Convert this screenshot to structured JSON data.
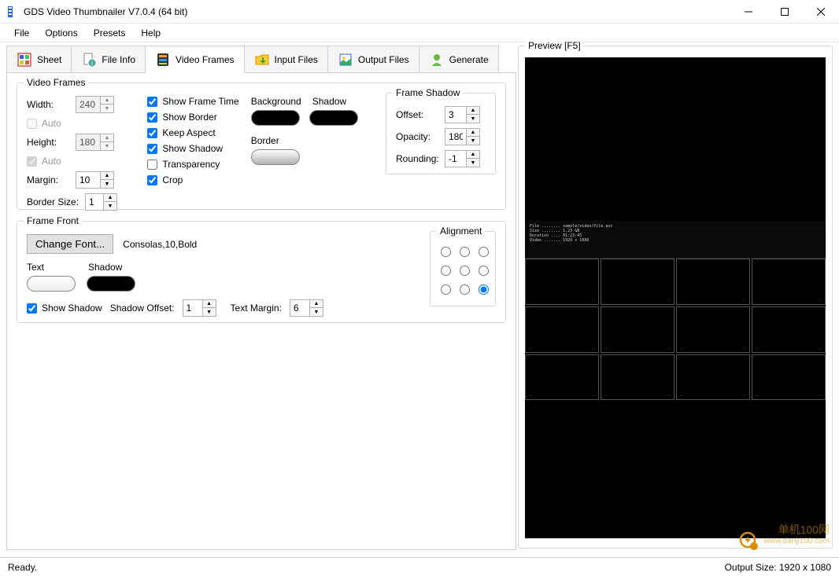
{
  "window": {
    "title": "GDS Video Thumbnailer V7.0.4 (64 bit)"
  },
  "menu": {
    "file": "File",
    "options": "Options",
    "presets": "Presets",
    "help": "Help"
  },
  "tabs": {
    "sheet": "Sheet",
    "fileinfo": "File Info",
    "videoframes": "Video Frames",
    "inputfiles": "Input Files",
    "outputfiles": "Output Files",
    "generate": "Generate"
  },
  "videoFrames": {
    "legend": "Video Frames",
    "width_label": "Width:",
    "width_value": "240",
    "width_auto": "Auto",
    "height_label": "Height:",
    "height_value": "180",
    "height_auto": "Auto",
    "margin_label": "Margin:",
    "margin_value": "10",
    "bordersize_label": "Border Size:",
    "bordersize_value": "1",
    "show_frame_time": "Show Frame Time",
    "show_border": "Show Border",
    "keep_aspect": "Keep Aspect",
    "show_shadow": "Show Shadow",
    "transparency": "Transparency",
    "crop": "Crop",
    "background_label": "Background",
    "shadow_label": "Shadow",
    "border_label": "Border"
  },
  "frameShadow": {
    "legend": "Frame Shadow",
    "offset_label": "Offset:",
    "offset_value": "3",
    "opacity_label": "Opacity:",
    "opacity_value": "180",
    "rounding_label": "Rounding:",
    "rounding_value": "-1"
  },
  "frameFont": {
    "legend": "Frame Front",
    "change_font": "Change Font...",
    "font_desc": "Consolas,10,Bold",
    "text_label": "Text",
    "shadow_label": "Shadow",
    "show_shadow": "Show Shadow",
    "shadow_offset_label": "Shadow Offset:",
    "shadow_offset_value": "1",
    "text_margin_label": "Text Margin:",
    "text_margin_value": "6",
    "alignment_legend": "Alignment"
  },
  "preview": {
    "legend": "Preview  [F5]"
  },
  "status": {
    "left": "Ready.",
    "right": "Output Size:  1920 x 1080"
  },
  "watermark": {
    "line1": "单机100网",
    "line2": "www.danji100.com"
  }
}
